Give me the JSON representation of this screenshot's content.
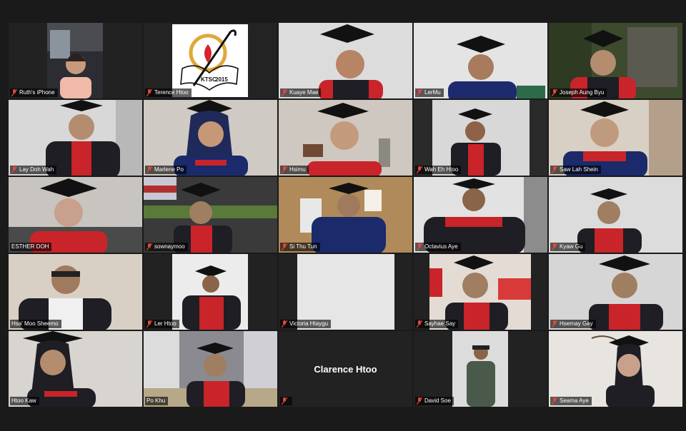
{
  "meeting": {
    "participants": [
      {
        "name": "Ruth's iPhone",
        "muted": true
      },
      {
        "name": "Terence Htoo",
        "muted": true,
        "active_speaker": true,
        "logo_text": "KTSC",
        "logo_year": "2015"
      },
      {
        "name": "Kuaye Mae",
        "muted": true
      },
      {
        "name": "LerMu",
        "muted": true
      },
      {
        "name": "Joseph Aung Byu",
        "muted": true
      },
      {
        "name": "Lay Doh Wah",
        "muted": true
      },
      {
        "name": "Marlene Po",
        "muted": true
      },
      {
        "name": "Hsimu",
        "muted": true
      },
      {
        "name": "Wah Eh Htoo",
        "muted": true
      },
      {
        "name": "Saw Lah Shein",
        "muted": true
      },
      {
        "name": "ESTHER DOH",
        "muted": false
      },
      {
        "name": "sownaymoo",
        "muted": true
      },
      {
        "name": "Si Thu Tun",
        "muted": true
      },
      {
        "name": "Octavius Aye",
        "muted": true
      },
      {
        "name": "Kyaw Gu",
        "muted": true
      },
      {
        "name": "Hsa' Moo Sheemo",
        "muted": false
      },
      {
        "name": "Ler Htoo",
        "muted": true
      },
      {
        "name": "Victoria Htaygu",
        "muted": true
      },
      {
        "name": "Sayhae Say",
        "muted": true
      },
      {
        "name": "Hsernay Gay",
        "muted": true
      },
      {
        "name": "Htoo Kaw",
        "muted": false
      },
      {
        "name": "Po Khu",
        "muted": false
      },
      {
        "name": "",
        "muted": true,
        "display_name": "Clarence Htoo",
        "video_off": true
      },
      {
        "name": "David Soe",
        "muted": true
      },
      {
        "name": "Seama Aye",
        "muted": true
      }
    ]
  },
  "colors": {
    "background": "#1a1a1a",
    "active_border": "#d8d87a",
    "mute_icon": "#e0463c",
    "gown_red": "#c8242a",
    "gown_black": "#1e1e24"
  }
}
